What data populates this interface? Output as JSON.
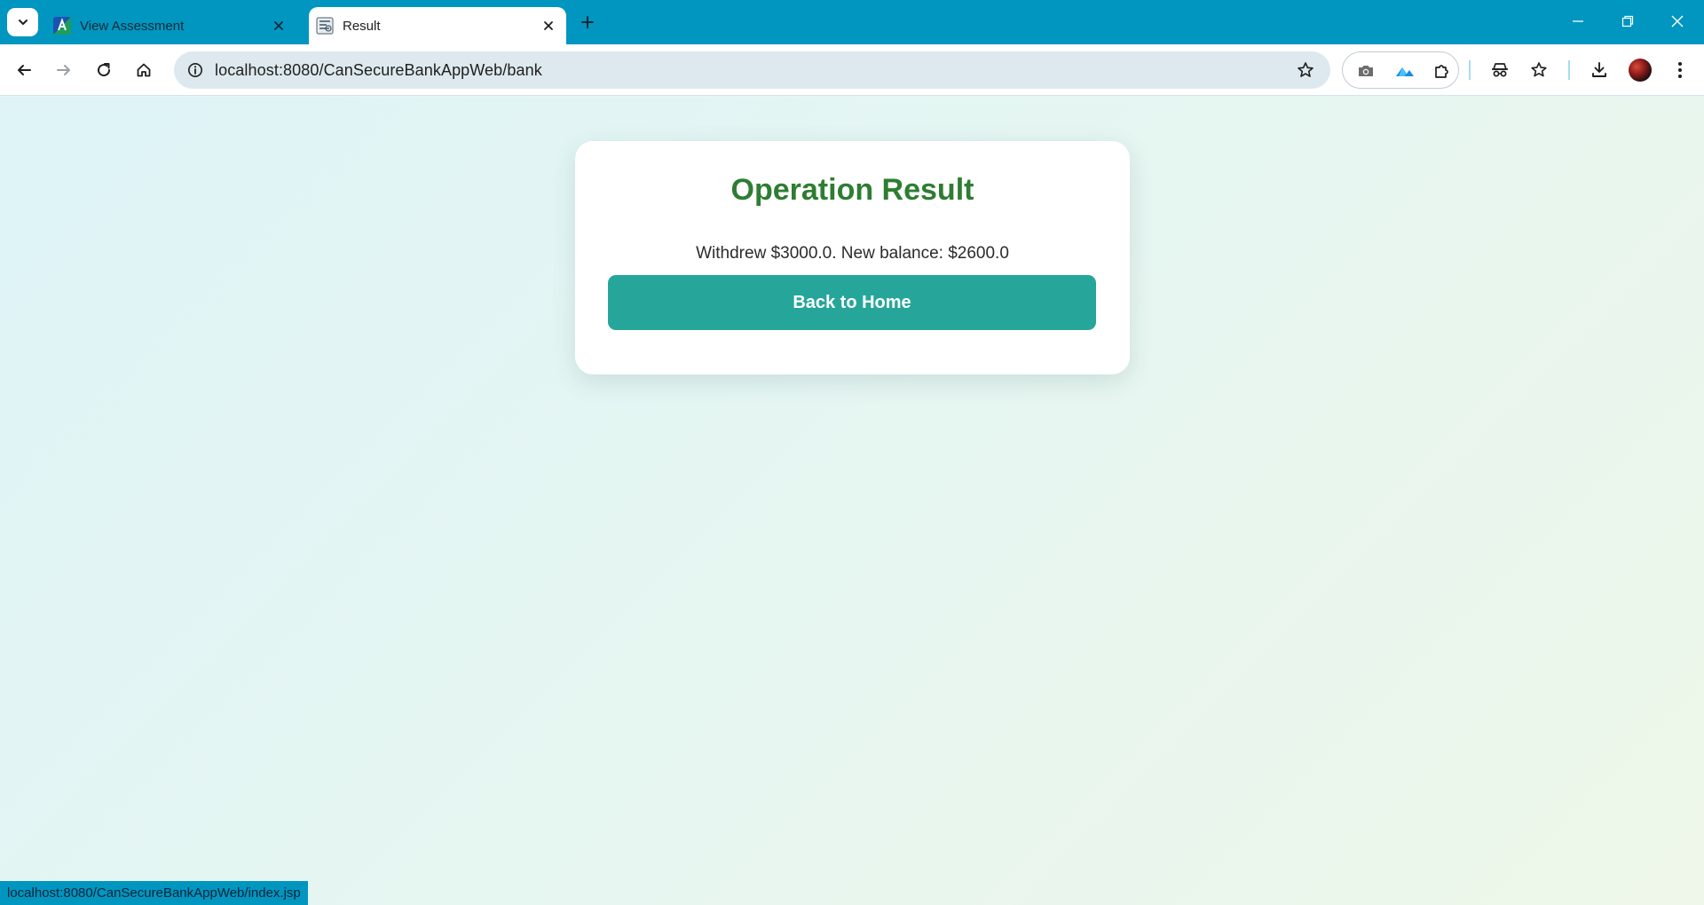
{
  "tabs": [
    {
      "title": "View Assessment",
      "favicon": "assessment-app-icon",
      "active": false
    },
    {
      "title": "Result",
      "favicon": "result-page-icon",
      "active": true
    }
  ],
  "toolbar": {
    "url": "localhost:8080/CanSecureBankAppWeb/bank"
  },
  "page": {
    "heading": "Operation Result",
    "message": "Withdrew $3000.0. New balance: $2600.0",
    "button_label": "Back to Home"
  },
  "status_bar": {
    "text": "localhost:8080/CanSecureBankAppWeb/index.jsp"
  },
  "colors": {
    "tab_strip": "#0096bf",
    "heading": "#2e7d32",
    "button": "#26a69a"
  }
}
